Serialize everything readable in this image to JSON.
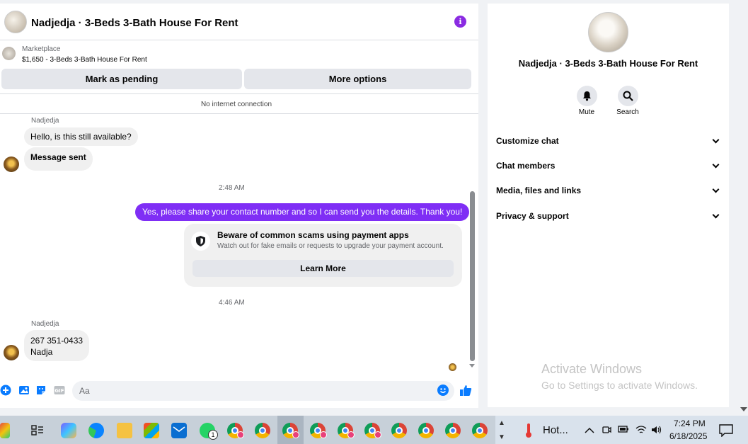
{
  "header": {
    "title": "Nadjedja · 3-Beds 3-Bath House For Rent",
    "info_icon": "i"
  },
  "marketplace": {
    "label": "Marketplace",
    "price_title": "$1,650 - 3-Beds 3-Bath House For Rent"
  },
  "actions": {
    "mark_pending": "Mark as pending",
    "more_options": "More options"
  },
  "status": {
    "no_internet": "No internet connection"
  },
  "messages": {
    "sender1": "Nadjedja",
    "msg1": "Hello, is this still available?",
    "msg2": "Message sent",
    "time1": "2:48 AM",
    "out1": "Yes, please share your contact number and so I can send you the details. Thank you!",
    "scam_title": "Beware of common scams using payment apps",
    "scam_sub": "Watch out for fake emails or requests to upgrade your payment account.",
    "learn_more": "Learn More",
    "time2": "4:46 AM",
    "sender2": "Nadjedja",
    "msg3_line1": "267 351-0433",
    "msg3_line2": "Nadja"
  },
  "composer": {
    "placeholder": "Aa"
  },
  "details": {
    "title": "Nadjedja · 3-Beds 3-Bath House For Rent",
    "mute": "Mute",
    "search": "Search",
    "sections": [
      "Customize chat",
      "Chat members",
      "Media, files and links",
      "Privacy & support"
    ]
  },
  "watermark": {
    "line1": "Activate Windows",
    "line2": "Go to Settings to activate Windows."
  },
  "taskbar": {
    "weather": "Hot...",
    "time": "7:24 PM",
    "date": "6/18/2025",
    "whatsapp_badge": "1"
  },
  "colors": {
    "accent": "#7f2ef5",
    "blue": "#0a7cff"
  }
}
